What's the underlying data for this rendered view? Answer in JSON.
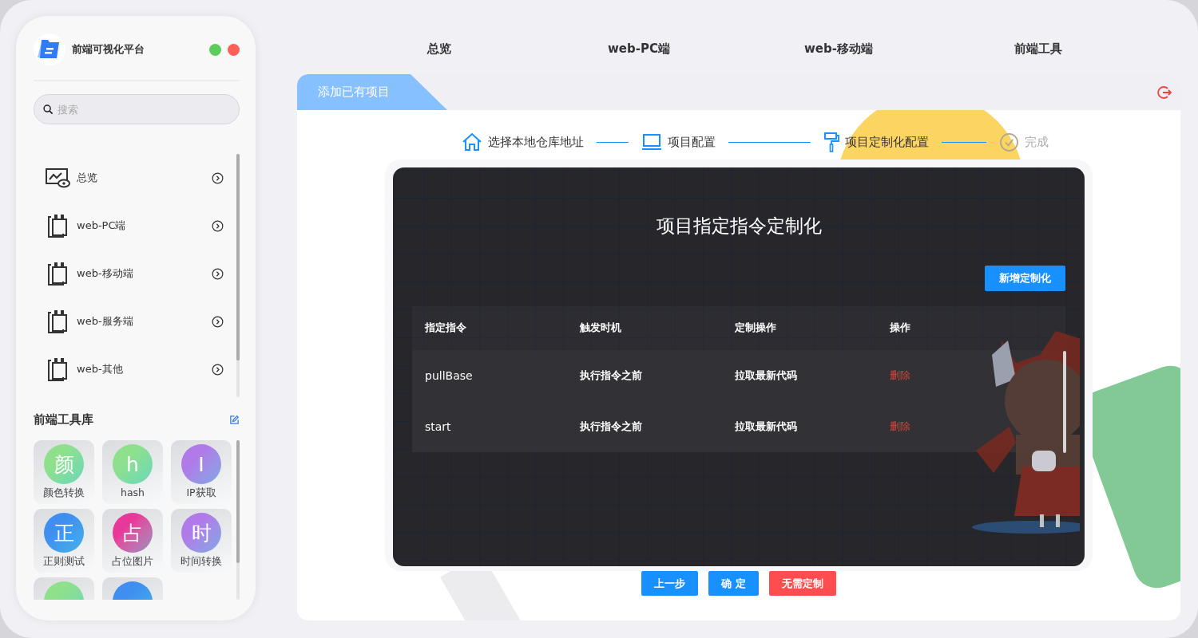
{
  "sidebar": {
    "title": "前端可视化平台",
    "search": {
      "placeholder": "搜索"
    },
    "nav": [
      {
        "label": "总览",
        "kind": "chart"
      },
      {
        "label": "web-PC端",
        "kind": "clipboard"
      },
      {
        "label": "web-移动端",
        "kind": "clipboard"
      },
      {
        "label": "web-服务端",
        "kind": "clipboard"
      },
      {
        "label": "web-其他",
        "kind": "clipboard"
      }
    ],
    "tools_title": "前端工具库",
    "tools": [
      {
        "glyph": "颜",
        "label": "颜色转换",
        "color": "#8ee08c"
      },
      {
        "glyph": "h",
        "label": "hash",
        "color": "#8ee08c"
      },
      {
        "glyph": "I",
        "label": "IP获取",
        "color": "#b07ae8"
      },
      {
        "glyph": "正",
        "label": "正则测试",
        "color": "#3f8ef0"
      },
      {
        "glyph": "占",
        "label": "占位图片",
        "color": "#e8389a"
      },
      {
        "glyph": "时",
        "label": "时间转换",
        "color": "#b07ae8"
      },
      {
        "color": "#8ee08c"
      },
      {
        "color": "#3f8ef0"
      }
    ]
  },
  "top_nav": [
    "总览",
    "web-PC端",
    "web-移动端",
    "前端工具"
  ],
  "panel": {
    "tab": "添加已有项目",
    "steps": [
      {
        "label": "选择本地仓库地址",
        "kind": "house",
        "done": true
      },
      {
        "label": "项目配置",
        "kind": "laptop",
        "done": true
      },
      {
        "label": "项目定制化配置",
        "kind": "roller",
        "done": true
      },
      {
        "label": "完成",
        "kind": "check",
        "done": false
      }
    ],
    "title": "项目指定指令定制化",
    "add_button": "新增定制化",
    "table": {
      "columns": [
        "指定指令",
        "触发时机",
        "定制操作",
        "操作"
      ],
      "rows": [
        {
          "command": "pullBase",
          "timing": "执行指令之前",
          "action": "拉取最新代码",
          "op": "删除"
        },
        {
          "command": "start",
          "timing": "执行指令之前",
          "action": "拉取最新代码",
          "op": "删除"
        }
      ]
    },
    "buttons": [
      {
        "label": "上一步",
        "kind": "primary"
      },
      {
        "label": "确 定",
        "kind": "primary"
      },
      {
        "label": "无需定制",
        "kind": "danger"
      }
    ]
  }
}
